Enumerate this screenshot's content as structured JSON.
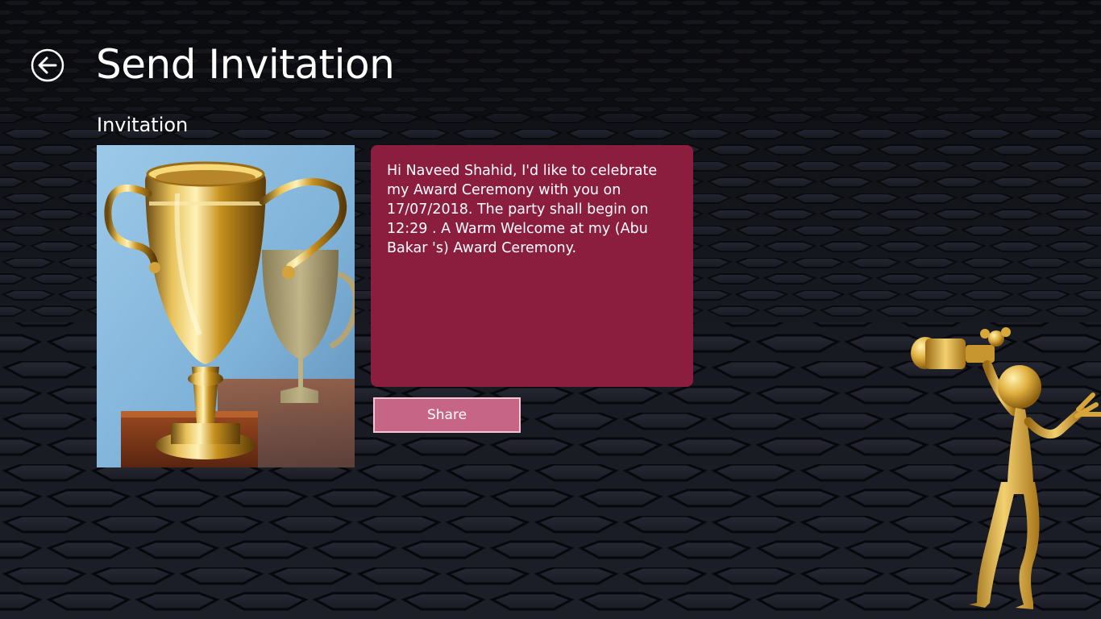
{
  "header": {
    "title": "Send Invitation",
    "back_icon": "back-arrow-circle-icon"
  },
  "section": {
    "heading": "Invitation"
  },
  "invitation": {
    "message": "Hi Naveed Shahid, I'd like to celebrate my Award Ceremony with you on 17/07/2018. The party shall begin on 12:29 . A Warm Welcome at my (Abu Bakar 's) Award Ceremony."
  },
  "actions": {
    "share_label": "Share"
  },
  "colors": {
    "background": "#141519",
    "message_box": "#8b1d3f",
    "share_button": "#c76586",
    "share_border": "#f2c7d4",
    "text": "#ffffff"
  },
  "images": {
    "photo": "gold-trophy-cup",
    "decoration": "gold-figure-holding-trophy"
  }
}
